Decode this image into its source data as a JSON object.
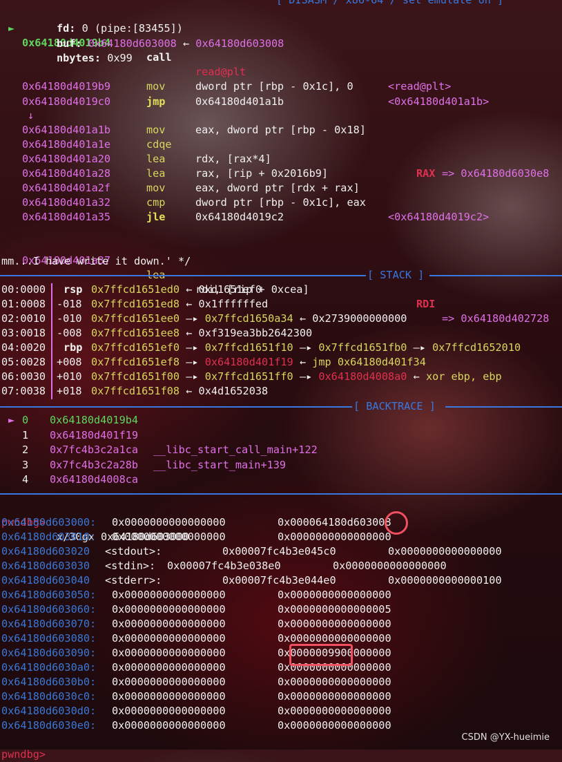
{
  "disasm_header": "[ DISASM / x86-64 / set emulate on ]",
  "disasm": {
    "current": {
      "marker": "►",
      "addr": "0x64180d4019b4",
      "op": "call",
      "arg": "read@plt",
      "note": "<read@plt>"
    },
    "call_args": [
      {
        "name": "fd:",
        "value": "0 (pipe:[83455])"
      },
      {
        "name": "buf:",
        "value": "0x64180d603008",
        "arrow": "←",
        "target": "0x64180d603008"
      },
      {
        "name": "nbytes:",
        "value": "0x99"
      }
    ],
    "lines1": [
      {
        "addr": "0x64180d4019b9",
        "op": "mov",
        "arg": "dword ptr [rbp - 0x1c], 0",
        "note": ""
      },
      {
        "addr": "0x64180d4019c0",
        "op": "jmp",
        "arg": "0x64180d401a1b",
        "note": "<0x64180d401a1b>"
      }
    ],
    "down_arrow": "↓",
    "lines2": [
      {
        "addr": "0x64180d401a1b",
        "op": "mov",
        "arg": "eax, dword ptr [rbp - 0x18]",
        "note": ""
      },
      {
        "addr": "0x64180d401a1e",
        "op": "cdqe",
        "arg": "",
        "note": ""
      },
      {
        "addr": "0x64180d401a20",
        "op": "lea",
        "arg": "rdx, [rax*4]",
        "note": ""
      },
      {
        "addr": "0x64180d401a28",
        "op": "lea",
        "arg": "rax, [rip + 0x2016b9]",
        "reg": "RAX",
        "regval": "=> 0x64180d6030e8"
      },
      {
        "addr": "0x64180d401a2f",
        "op": "mov",
        "arg": "eax, dword ptr [rdx + rax]",
        "note": ""
      },
      {
        "addr": "0x64180d401a32",
        "op": "cmp",
        "arg": "dword ptr [rbp - 0x1c], eax",
        "note": ""
      },
      {
        "addr": "0x64180d401a35",
        "op": "jle",
        "arg": "0x64180d4019c2",
        "note": "<0x64180d4019c2>"
      }
    ],
    "last": {
      "addr": "0x64180d401a37",
      "op": "lea",
      "arg": "rdi, [rip + 0xcea]",
      "reg": "RDI",
      "regval": "=> 0x64180d402728"
    },
    "comment_tail": "mm...I have write it down.' */"
  },
  "stack_header": "[ STACK ]",
  "stack": [
    {
      "idx": "00:0000",
      "reg": "rsp",
      "off": "",
      "addr": "0x7ffcd1651ed0",
      "chain": [
        [
          "←",
          "0xd1651ef0",
          "white"
        ]
      ]
    },
    {
      "idx": "01:0008",
      "reg": "",
      "off": "-018",
      "addr": "0x7ffcd1651ed8",
      "chain": [
        [
          "←",
          "0x1ffffffed",
          "white"
        ]
      ]
    },
    {
      "idx": "02:0010",
      "reg": "",
      "off": "-010",
      "addr": "0x7ffcd1651ee0",
      "chain": [
        [
          "—▸",
          "0x7ffcd1650a34",
          "yel"
        ],
        [
          "←",
          "0x2739000000000",
          "white"
        ]
      ]
    },
    {
      "idx": "03:0018",
      "reg": "",
      "off": "-008",
      "addr": "0x7ffcd1651ee8",
      "chain": [
        [
          "←",
          "0xf319ea3bb2642300",
          "white"
        ]
      ]
    },
    {
      "idx": "04:0020",
      "reg": "rbp",
      "off": "",
      "addr": "0x7ffcd1651ef0",
      "chain": [
        [
          "—▸",
          "0x7ffcd1651f10",
          "yel"
        ],
        [
          "—▸",
          "0x7ffcd1651fb0",
          "yel"
        ],
        [
          "—▸",
          "0x7ffcd1652010",
          "yel"
        ]
      ]
    },
    {
      "idx": "05:0028",
      "reg": "",
      "off": "+008",
      "addr": "0x7ffcd1651ef8",
      "chain": [
        [
          "—▸",
          "0x64180d401f19",
          "red"
        ],
        [
          "←",
          "jmp 0x64180d401f34",
          "insn"
        ]
      ]
    },
    {
      "idx": "06:0030",
      "reg": "",
      "off": "+010",
      "addr": "0x7ffcd1651f00",
      "chain": [
        [
          "—▸",
          "0x7ffcd1651ff0",
          "yel"
        ],
        [
          "—▸",
          "0x64180d4008a0",
          "red"
        ],
        [
          "←",
          "xor ebp, ebp",
          "insn"
        ]
      ]
    },
    {
      "idx": "07:0038",
      "reg": "",
      "off": "+018",
      "addr": "0x7ffcd1651f08",
      "chain": [
        [
          "←",
          "0x4d1652038",
          "white"
        ]
      ]
    }
  ],
  "backtrace_header": "[ BACKTRACE ]",
  "backtrace": [
    {
      "marker": "►",
      "num": "0",
      "addr": "0x64180d4019b4",
      "sym": ""
    },
    {
      "marker": "",
      "num": "1",
      "addr": "0x64180d401f19",
      "sym": ""
    },
    {
      "marker": "",
      "num": "2",
      "addr": "0x7fc4b3c2a1ca",
      "sym": "__libc_start_call_main+122"
    },
    {
      "marker": "",
      "num": "3",
      "addr": "0x7fc4b3c2a28b",
      "sym": "__libc_start_main+139"
    },
    {
      "marker": "",
      "num": "4",
      "addr": "0x64180d4008ca",
      "sym": ""
    }
  ],
  "prompt": "pwndbg>",
  "command": "x/30gx 0x64180d603000",
  "memory": [
    {
      "addr": "0x64180d603000:",
      "label": "",
      "v1": "0x0000000000000000",
      "v2": "0x000064180d603008"
    },
    {
      "addr": "0x64180d603010:",
      "label": "",
      "v1": "0x0000000000000000",
      "v2": "0x0000000000000000"
    },
    {
      "addr": "0x64180d603020",
      "label": "<stdout>:",
      "v1": "0x00007fc4b3e045c0",
      "v2": "0x0000000000000000"
    },
    {
      "addr": "0x64180d603030",
      "label": "<stdin>:",
      "v1": "0x00007fc4b3e038e0",
      "v2": "0x0000000000000000"
    },
    {
      "addr": "0x64180d603040",
      "label": "<stderr>:",
      "v1": "0x00007fc4b3e044e0",
      "v2": "0x0000000000000100"
    },
    {
      "addr": "0x64180d603050:",
      "label": "",
      "v1": "0x0000000000000000",
      "v2": "0x0000000000000000"
    },
    {
      "addr": "0x64180d603060:",
      "label": "",
      "v1": "0x0000000000000000",
      "v2": "0x0000000000000005"
    },
    {
      "addr": "0x64180d603070:",
      "label": "",
      "v1": "0x0000000000000000",
      "v2": "0x0000000000000000"
    },
    {
      "addr": "0x64180d603080:",
      "label": "",
      "v1": "0x0000000000000000",
      "v2": "0x0000000000000000"
    },
    {
      "addr": "0x64180d603090:",
      "label": "",
      "v1": "0x0000000000000000",
      "v2": "0x0000009900000000"
    },
    {
      "addr": "0x64180d6030a0:",
      "label": "",
      "v1": "0x0000000000000000",
      "v2": "0x0000000000000000"
    },
    {
      "addr": "0x64180d6030b0:",
      "label": "",
      "v1": "0x0000000000000000",
      "v2": "0x0000000000000000"
    },
    {
      "addr": "0x64180d6030c0:",
      "label": "",
      "v1": "0x0000000000000000",
      "v2": "0x0000000000000000"
    },
    {
      "addr": "0x64180d6030d0:",
      "label": "",
      "v1": "0x0000000000000000",
      "v2": "0x0000000000000000"
    },
    {
      "addr": "0x64180d6030e0:",
      "label": "",
      "v1": "0x0000000000000000",
      "v2": "0x0000000000000000"
    }
  ],
  "watermark": "CSDN @YX-hueimie",
  "colors": {
    "separator": "#3878e0",
    "highlight": "#f05060",
    "address_blue": "#3a78d8",
    "prompt_red": "#e03050"
  }
}
